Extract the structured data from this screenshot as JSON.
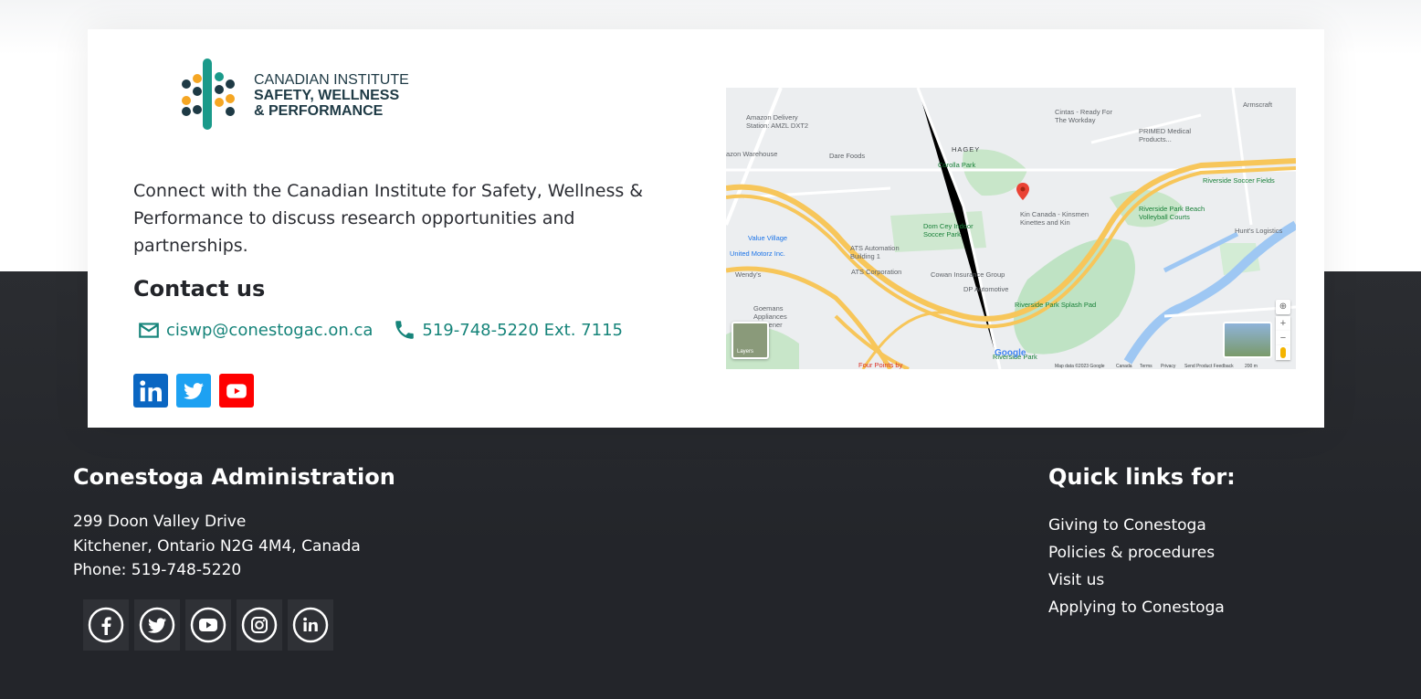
{
  "card": {
    "logo": {
      "line1": "CANADIAN INSTITUTE",
      "line2": "SAFETY, WELLNESS",
      "line3": "& PERFORMANCE"
    },
    "intro": "Connect with the Canadian Institute for Safety, Wellness & Performance to discuss research opportunities and partnerships.",
    "contact_title": "Contact us",
    "email": "ciswp@conestogac.on.ca",
    "phone": "519-748-5220 Ext. 7115",
    "social": [
      "linkedin-icon",
      "twitter-icon",
      "youtube-icon"
    ]
  },
  "map": {
    "labels": {
      "amazon": "Amazon Delivery Station: AMZL DXT2",
      "cintas": "Cintas - Ready For The Workday",
      "armscraft": "Armscraft",
      "primed": "PRIMED Medical Products...",
      "amazon_wh": "azon Warehouse",
      "dare": "Dare Foods",
      "hagey": "HAGEY",
      "corolla": "Corolla Park",
      "riverside_soccer": "Riverside Soccer Fields",
      "kin": "Kin Canada - Kinsmen Kinettes and Kin",
      "riverside_vb": "Riverside Park Beach Volleyball Courts",
      "hunts": "Hunt's Logistics",
      "dom": "Dom Cey Indoor Soccer Park",
      "value": "Value Village",
      "ats1": "ATS Automation Building 1",
      "ats": "ATS Corporation",
      "cowan": "Cowan Insurance Group",
      "united": "United Motorz Inc.",
      "dp": "DP Automotive",
      "splash": "Riverside Park Splash Pad",
      "wendys": "Wendy's",
      "goemans": "Goemans Appliances Kitchener",
      "riverside": "Riverside Park",
      "fourpoints": "Four Points by",
      "google": "Google",
      "layers": "Layers",
      "mapdata": "Map data ©2023 Google",
      "canada": "Canada",
      "terms": "Terms",
      "privacy": "Privacy",
      "feedback": "Send Product Feedback",
      "scale": "200 m"
    }
  },
  "footer": {
    "admin_title": "Conestoga Administration",
    "address_line1": "299 Doon Valley Drive",
    "address_line2": "Kitchener, Ontario N2G 4M4, Canada",
    "phone": "Phone: 519-748-5220",
    "social": [
      "facebook-icon",
      "twitter-icon",
      "youtube-icon",
      "instagram-icon",
      "linkedin-icon"
    ],
    "quick_title": "Quick links for:",
    "quick_links": [
      "Giving to Conestoga",
      "Policies & procedures",
      "Visit us",
      "Applying to Conestoga"
    ]
  },
  "colors": {
    "teal": "#16847a",
    "dark": "#23252a",
    "logo_orange": "#f5a623",
    "logo_green": "#1a9a8a"
  }
}
